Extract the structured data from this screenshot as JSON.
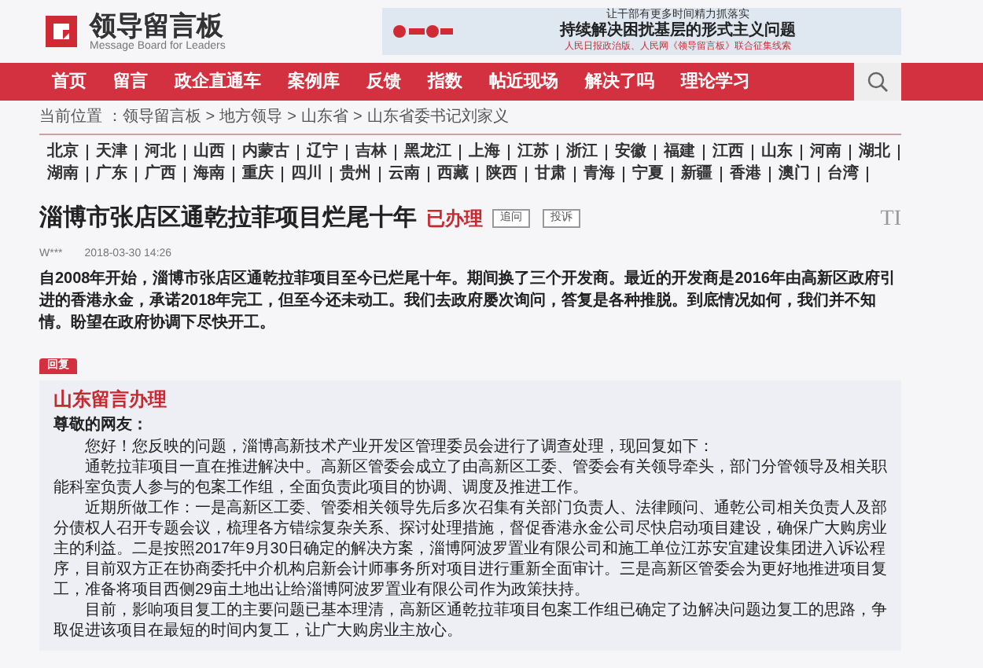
{
  "logo": {
    "title": "领导留言板",
    "subtitle": "Message Board for Leaders"
  },
  "banner": {
    "line_1": "让干部有更多时间精力抓落实",
    "line_2": "持续解决困扰基层的形式主义问题",
    "line_3": "人民日报政治版、人民网《领导留言板》联合征集线索"
  },
  "nav": [
    {
      "label": "首页"
    },
    {
      "label": "留言"
    },
    {
      "label": "政企直通车"
    },
    {
      "label": "案例库"
    },
    {
      "label": "反馈"
    },
    {
      "label": "指数"
    },
    {
      "label": "帖近现场"
    },
    {
      "label": "解决了吗"
    },
    {
      "label": "理论学习"
    }
  ],
  "breadcrumb": {
    "separator": ">",
    "items": [
      "当前位置 ：领导留言板",
      "地方领导",
      "山东省",
      "山东省委书记刘家义"
    ]
  },
  "regions": [
    "北京",
    "天津",
    "河北",
    "山西",
    "内蒙古",
    "辽宁",
    "吉林",
    "黑龙江",
    "上海",
    "江苏",
    "浙江",
    "安徽",
    "福建",
    "江西",
    "山东",
    "河南",
    "湖北",
    "湖南",
    "广东",
    "广西",
    "海南",
    "重庆",
    "四川",
    "贵州",
    "云南",
    "西藏",
    "陕西",
    "甘肃",
    "青海",
    "宁夏",
    "新疆",
    "香港",
    "澳门",
    "台湾"
  ],
  "post": {
    "title": "淄博市张店区通乾拉菲项目烂尾十年",
    "status": "已办理",
    "actions": [
      "追问",
      "投诉"
    ],
    "corner_mark": "TI",
    "author": "W***",
    "time": "2018-03-30 14:26",
    "body": "自2008年开始，淄博市张店区通乾拉菲项目至今已烂尾十年。期间换了三个开发商。最近的开发商是2016年由高新区政府引进的香港永金，承诺2018年完工，但至今还未动工。我们去政府屡次询问，答复是各种推脱。到底情况如何，我们并不知情。盼望在政府协调下尽快开工。"
  },
  "reply": {
    "badge": "回复",
    "from": "山东留言办理",
    "greeting": "尊敬的网友：",
    "paragraphs": [
      "您好！您反映的问题，淄博高新技术产业开发区管理委员会进行了调查处理，现回复如下：",
      "通乾拉菲项目一直在推进解决中。高新区管委会成立了由高新区工委、管委会有关领导牵头，部门分管领导及相关职能科室负责人参与的包案工作组，全面负责此项目的协调、调度及推进工作。",
      "近期所做工作：一是高新区工委、管委相关领导先后多次召集有关部门负责人、法律顾问、通乾公司相关负责人及部分债权人召开专题会议，梳理各方错综复杂关系、探讨处理措施，督促香港永金公司尽快启动项目建设，确保广大购房业主的利益。二是按照2017年9月30日确定的解决方案，淄博阿波罗置业有限公司和施工单位江苏安宜建设集团进入诉讼程序，目前双方正在协商委托中介机构启新会计师事务所对项目进行重新全面审计。三是高新区管委会为更好地推进项目复工，准备将项目西侧29亩土地出让给淄博阿波罗置业有限公司作为政策扶持。",
      "目前，影响项目复工的主要问题已基本理清，高新区通乾拉菲项目包案工作组已确定了边解决问题边复工的思路，争取促进该项目在最短的时间内复工，让广大购房业主放心。"
    ]
  }
}
